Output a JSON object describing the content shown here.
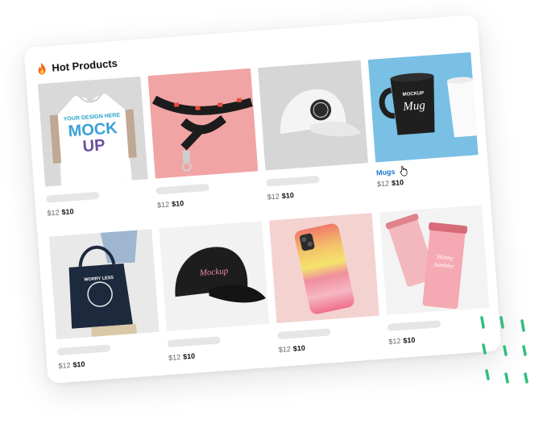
{
  "header": {
    "title": "Hot Products",
    "icon": "fire-icon"
  },
  "products": [
    {
      "id": "tshirt",
      "image_text_1": "YOUR DESIGN HERE",
      "image_text_2": "MOCK",
      "image_text_3": "UP",
      "old_price": "$12",
      "new_price": "$10"
    },
    {
      "id": "lanyard",
      "old_price": "$12",
      "new_price": "$10"
    },
    {
      "id": "cap-white",
      "old_price": "$12",
      "new_price": "$10"
    },
    {
      "id": "mug",
      "name": "Mugs",
      "image_text_1": "MOCKUP",
      "image_text_2": "Mug",
      "old_price": "$12",
      "new_price": "$10"
    },
    {
      "id": "tote",
      "image_text_1": "WORRY LESS",
      "old_price": "$12",
      "new_price": "$10"
    },
    {
      "id": "cap-black",
      "image_text_1": "Mockup",
      "old_price": "$12",
      "new_price": "$10"
    },
    {
      "id": "phone-case",
      "old_price": "$12",
      "new_price": "$10"
    },
    {
      "id": "tumbler",
      "image_text_1": "Skinny",
      "image_text_2": "tumbler",
      "old_price": "$12",
      "new_price": "$10"
    }
  ],
  "colors": {
    "accent": "#1b76d1",
    "decor_dots": "#2ebf7a",
    "placeholder_bar": "#e6e6e6"
  }
}
